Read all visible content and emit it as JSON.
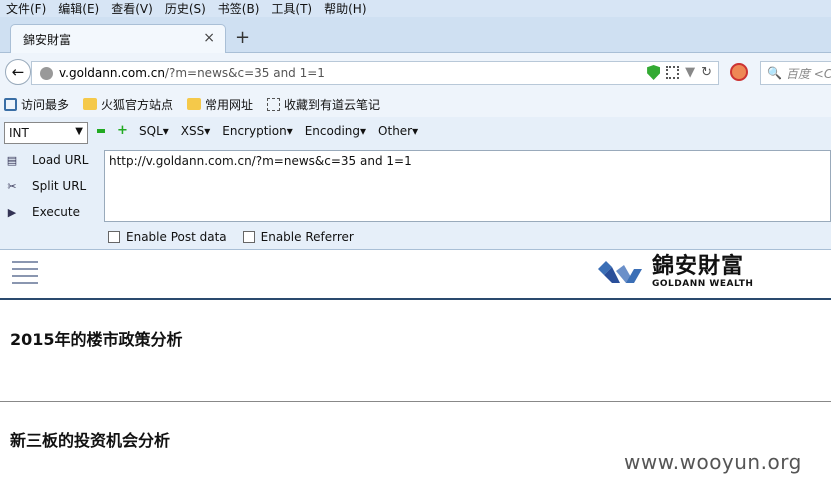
{
  "menubar": {
    "items": [
      "文件(F)",
      "编辑(E)",
      "查看(V)",
      "历史(S)",
      "书签(B)",
      "工具(T)",
      "帮助(H)"
    ]
  },
  "tab": {
    "title": "錦安財富",
    "close": "×",
    "new": "+"
  },
  "nav": {
    "url_host": "v.goldann.com.cn",
    "url_rest": "/?m=news&c=35 and 1=1",
    "search_placeholder": "百度 <C"
  },
  "bookmarks": [
    "访问最多",
    "火狐官方站点",
    "常用网址",
    "收藏到有道云笔记"
  ],
  "hackbar": {
    "select_value": "INT",
    "tools": [
      "SQL▾",
      "XSS▾",
      "Encryption▾",
      "Encoding▾",
      "Other▾"
    ],
    "load": "Load URL",
    "split": "Split URL",
    "execute": "Execute",
    "textarea_value": "http://v.goldann.com.cn/?m=news&c=35 and 1=1",
    "post_label": "Enable Post data",
    "referrer_label": "Enable Referrer"
  },
  "site": {
    "logo_cn": "錦安財富",
    "logo_en": "GOLDANN WEALTH",
    "articles": [
      "2015年的楼市政策分析",
      "新三板的投资机会分析"
    ]
  },
  "watermark": "www.wooyun.org"
}
